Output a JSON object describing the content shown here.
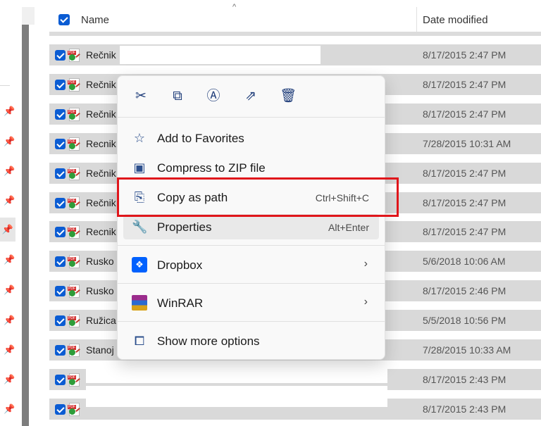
{
  "header": {
    "name_label": "Name",
    "date_label": "Date modified"
  },
  "rows": [
    {
      "name": "Rečnik",
      "date": "8/17/2015 2:47 PM"
    },
    {
      "name": "Rečnik",
      "date": "8/17/2015 2:47 PM"
    },
    {
      "name": "Rečnik",
      "date": "8/17/2015 2:47 PM"
    },
    {
      "name": "Recnik",
      "date": "7/28/2015 10:31 AM"
    },
    {
      "name": "Rečnik",
      "date": "8/17/2015 2:47 PM"
    },
    {
      "name": "Rečnik",
      "date": "8/17/2015 2:47 PM"
    },
    {
      "name": "Recnik",
      "date": "8/17/2015 2:47 PM"
    },
    {
      "name": "Rusko",
      "date": "5/6/2018 10:06 AM"
    },
    {
      "name": "Rusko",
      "date": "8/17/2015 2:46 PM"
    },
    {
      "name": "Ružica",
      "date": "5/5/2018 10:56 PM"
    },
    {
      "name": "Stanoj",
      "date": "7/28/2015 10:33 AM"
    },
    {
      "name": "",
      "date": "8/17/2015 2:43 PM"
    },
    {
      "name": "",
      "date": "8/17/2015 2:43 PM"
    }
  ],
  "context_menu": {
    "quick_actions": [
      "cut-icon",
      "copy-icon",
      "rename-icon",
      "share-icon",
      "delete-icon"
    ],
    "items": [
      {
        "label": "Add to Favorites",
        "shortcut": "",
        "icon": "star-icon"
      },
      {
        "label": "Compress to ZIP file",
        "shortcut": "",
        "icon": "zip-icon"
      },
      {
        "label": "Copy as path",
        "shortcut": "Ctrl+Shift+C",
        "icon": "copy-path-icon"
      },
      {
        "label": "Properties",
        "shortcut": "Alt+Enter",
        "icon": "wrench-icon"
      },
      {
        "label": "Dropbox",
        "shortcut": "",
        "icon": "dropbox-icon"
      },
      {
        "label": "WinRAR",
        "shortcut": "",
        "icon": "winrar-icon"
      },
      {
        "label": "Show more options",
        "shortcut": "",
        "icon": "show-more-icon"
      }
    ]
  },
  "colors": {
    "accent": "#0b5cd3",
    "highlight_border": "#e0161b",
    "row_selected": "#d9d9d9"
  }
}
